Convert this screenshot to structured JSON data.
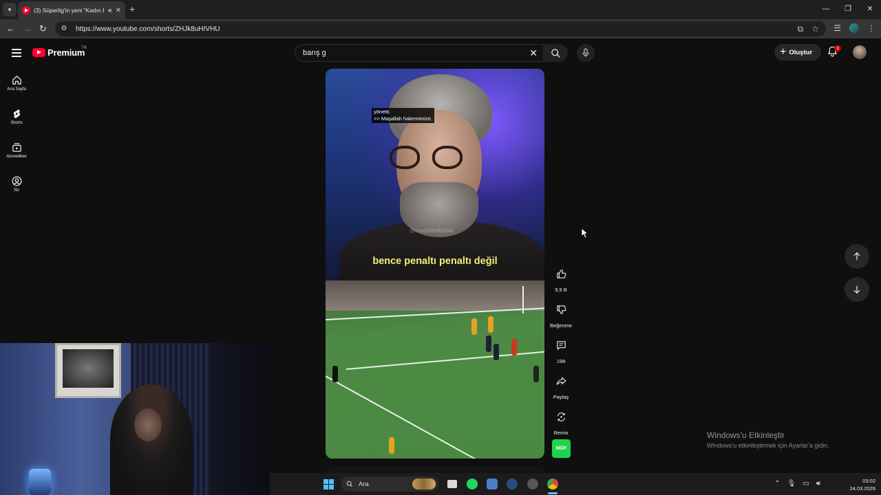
{
  "browser": {
    "tab_title": "(3) Süperlig'in yeni \"Kadın İ",
    "url": "https://www.youtube.com/shorts/ZHJk8uHIVHU"
  },
  "header": {
    "logo_text": "Premium",
    "region": "TR",
    "search_value": "barış g",
    "create_label": "Oluştur",
    "notification_count": "3"
  },
  "guide": [
    {
      "label": "Ana Sayfa",
      "icon": "home-icon"
    },
    {
      "label": "Shorts",
      "icon": "shorts-icon"
    },
    {
      "label": "Abonelikler",
      "icon": "subscriptions-icon"
    },
    {
      "label": "Siz",
      "icon": "you-icon"
    }
  ],
  "short": {
    "cc_line1": "yönetti.",
    "cc_line2": ">> Maşallah hakemimize.",
    "watermark": "@maçötesifutbol",
    "caption": "bence penaltı penaltı değil",
    "channel_thumb_text": "MÖF"
  },
  "actions": {
    "like_count": "9,9 B",
    "dislike_label": "Beğenme",
    "comment_count": "198",
    "share_label": "Paylaş",
    "remix_label": "Remix"
  },
  "windows": {
    "activate_title": "Windows'u Etkinleştir",
    "activate_sub": "Windows'u etkinleştirmek için Ayarlar'a gidin.",
    "search_label": "Ara",
    "time": "03:02",
    "date": "24.03.2026"
  },
  "colors": {
    "yt_red": "#ff0033",
    "caption_yellow": "#f4ef74",
    "background": "#0f0f0f"
  }
}
